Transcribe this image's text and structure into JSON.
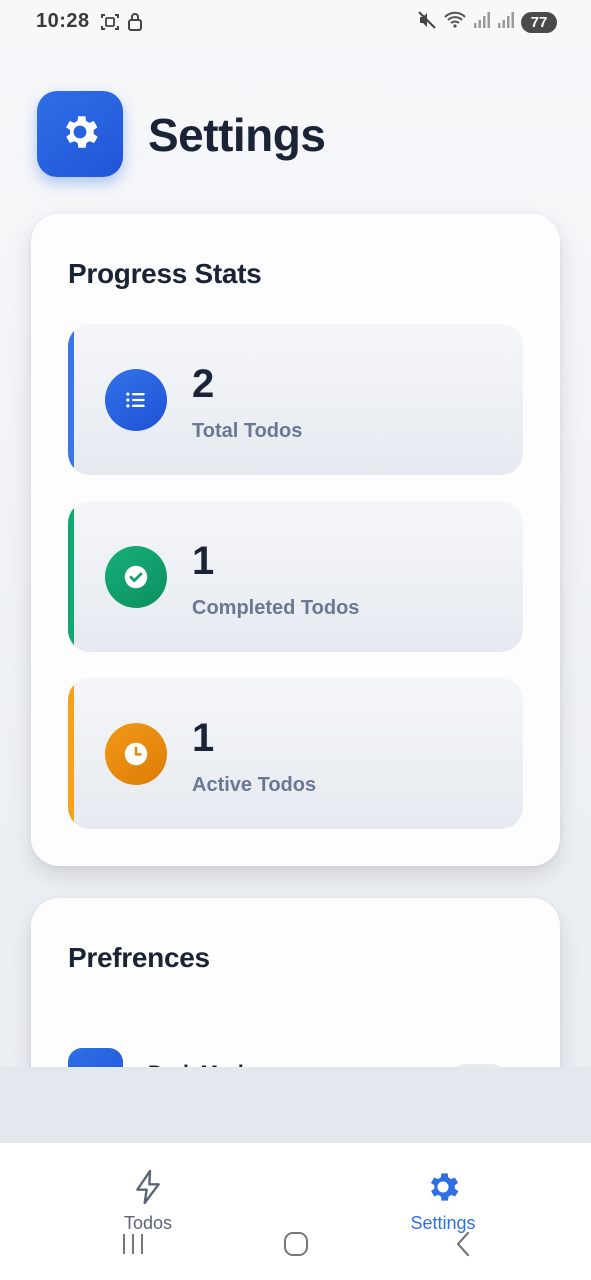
{
  "status_bar": {
    "time": "10:28",
    "battery": "77",
    "left_icons": [
      "screenshot-icon",
      "lock-icon"
    ],
    "right_icons": [
      "mute-icon",
      "wifi-icon",
      "signal-icon",
      "signal-icon"
    ]
  },
  "header": {
    "title": "Settings",
    "icon": "gear-icon",
    "accent_color": "#2563eb"
  },
  "progress_stats": {
    "title": "Progress Stats",
    "stats": [
      {
        "value": "2",
        "label": "Total Todos",
        "icon": "list-icon",
        "color": "#2563eb"
      },
      {
        "value": "1",
        "label": "Completed Todos",
        "icon": "check-circle-icon",
        "color": "#10a36a"
      },
      {
        "value": "1",
        "label": "Active Todos",
        "icon": "clock-icon",
        "color": "#f59e0b"
      }
    ]
  },
  "preferences": {
    "title": "Prefrences",
    "items": [
      {
        "label": "Dark Mode",
        "icon": "moon-icon",
        "toggle": false
      }
    ]
  },
  "bottom_nav": {
    "items": [
      {
        "label": "Todos",
        "icon": "lightning-icon",
        "active": false
      },
      {
        "label": "Settings",
        "icon": "gear-icon",
        "active": true
      }
    ]
  },
  "system_nav": [
    "recent-apps-icon",
    "home-icon",
    "back-icon"
  ]
}
